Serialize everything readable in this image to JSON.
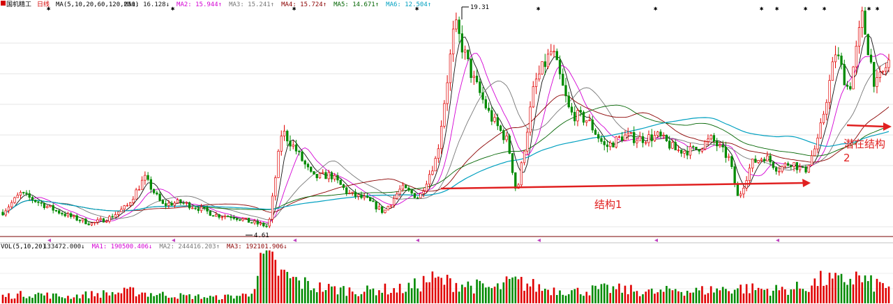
{
  "chart_data": {
    "type": "candlestick",
    "stock_name": "国机精工",
    "period_label": "日线",
    "ma_header": "MA(5,10,20,60,120,250)",
    "ma_indicators": [
      {
        "label": "MA1:",
        "value": "16.128",
        "arrow": "↓",
        "color": "#111111"
      },
      {
        "label": "MA2:",
        "value": "15.944",
        "arrow": "↑",
        "color": "#d400d4"
      },
      {
        "label": "MA3:",
        "value": "15.241",
        "arrow": "↑",
        "color": "#777777"
      },
      {
        "label": "MA4:",
        "value": "15.724",
        "arrow": "↑",
        "color": "#8b0000"
      },
      {
        "label": "MA5:",
        "value": "14.671",
        "arrow": "↑",
        "color": "#006400"
      },
      {
        "label": "MA6:",
        "value": "12.504",
        "arrow": "↑",
        "color": "#00a0c0"
      }
    ],
    "high_label": "19.31",
    "low_label": "4.61",
    "volume_header": "VOL(5,10,20)",
    "volume_indicators": [
      {
        "label": "",
        "value": "133472.000",
        "arrow": "↓",
        "color": "#111111"
      },
      {
        "label": "MA1:",
        "value": "190500.406",
        "arrow": "↓",
        "color": "#d400d4"
      },
      {
        "label": "MA2:",
        "value": "244416.203",
        "arrow": "↑",
        "color": "#777777"
      },
      {
        "label": "MA3:",
        "value": "192101.906",
        "arrow": "↓",
        "color": "#8b0000"
      }
    ],
    "annotations": [
      {
        "text": "结构1",
        "color": "#e02020"
      },
      {
        "text": "潜在结构",
        "color": "#e02020"
      },
      {
        "text": "2",
        "color": "#e02020"
      }
    ],
    "price_series": [
      {
        "t": 0,
        "p": 5.6
      },
      {
        "t": 0.02,
        "p": 6.9
      },
      {
        "t": 0.04,
        "p": 6.3
      },
      {
        "t": 0.06,
        "p": 5.7
      },
      {
        "t": 0.08,
        "p": 5.2
      },
      {
        "t": 0.1,
        "p": 4.8
      },
      {
        "t": 0.12,
        "p": 5.2
      },
      {
        "t": 0.14,
        "p": 6.0
      },
      {
        "t": 0.16,
        "p": 8.0
      },
      {
        "t": 0.18,
        "p": 6.1
      },
      {
        "t": 0.2,
        "p": 6.3
      },
      {
        "t": 0.22,
        "p": 5.9
      },
      {
        "t": 0.24,
        "p": 5.4
      },
      {
        "t": 0.26,
        "p": 5.3
      },
      {
        "t": 0.28,
        "p": 4.9
      },
      {
        "t": 0.3,
        "p": 4.6
      },
      {
        "t": 0.315,
        "p": 11.3
      },
      {
        "t": 0.33,
        "p": 10.0
      },
      {
        "t": 0.35,
        "p": 8.0
      },
      {
        "t": 0.37,
        "p": 8.2
      },
      {
        "t": 0.39,
        "p": 6.9
      },
      {
        "t": 0.41,
        "p": 6.5
      },
      {
        "t": 0.43,
        "p": 5.6
      },
      {
        "t": 0.45,
        "p": 7.3
      },
      {
        "t": 0.47,
        "p": 6.6
      },
      {
        "t": 0.49,
        "p": 9.5
      },
      {
        "t": 0.51,
        "p": 18.7
      },
      {
        "t": 0.53,
        "p": 15.0
      },
      {
        "t": 0.55,
        "p": 12.3
      },
      {
        "t": 0.57,
        "p": 10.5
      },
      {
        "t": 0.58,
        "p": 6.8
      },
      {
        "t": 0.6,
        "p": 14.5
      },
      {
        "t": 0.62,
        "p": 16.9
      },
      {
        "t": 0.64,
        "p": 12.5
      },
      {
        "t": 0.66,
        "p": 12.0
      },
      {
        "t": 0.68,
        "p": 10.1
      },
      {
        "t": 0.7,
        "p": 10.9
      },
      {
        "t": 0.72,
        "p": 10.7
      },
      {
        "t": 0.74,
        "p": 10.9
      },
      {
        "t": 0.76,
        "p": 9.9
      },
      {
        "t": 0.78,
        "p": 9.9
      },
      {
        "t": 0.8,
        "p": 10.7
      },
      {
        "t": 0.82,
        "p": 9.3
      },
      {
        "t": 0.83,
        "p": 6.5
      },
      {
        "t": 0.845,
        "p": 9.0
      },
      {
        "t": 0.86,
        "p": 9.5
      },
      {
        "t": 0.875,
        "p": 8.6
      },
      {
        "t": 0.89,
        "p": 9.1
      },
      {
        "t": 0.905,
        "p": 8.4
      },
      {
        "t": 0.92,
        "p": 10.5
      },
      {
        "t": 0.94,
        "p": 16.8
      },
      {
        "t": 0.955,
        "p": 14.0
      },
      {
        "t": 0.97,
        "p": 19.2
      },
      {
        "t": 0.985,
        "p": 14.3
      },
      {
        "t": 1,
        "p": 16.1
      }
    ],
    "volume_series": [
      0.15,
      0.18,
      0.2,
      0.16,
      0.14,
      0.18,
      0.2,
      0.22,
      0.25,
      0.2,
      0.18,
      0.15,
      0.14,
      0.12,
      0.15,
      0.18,
      1.0,
      0.6,
      0.45,
      0.35,
      0.3,
      0.28,
      0.25,
      0.3,
      0.28,
      0.35,
      0.5,
      0.45,
      0.4,
      0.35,
      0.3,
      0.45,
      0.4,
      0.3,
      0.28,
      0.25,
      0.28,
      0.3,
      0.28,
      0.25,
      0.22,
      0.3,
      0.25,
      0.28,
      0.3,
      0.32,
      0.3,
      0.28,
      0.3,
      0.35,
      0.5,
      0.45,
      0.55,
      0.4,
      0.38
    ]
  }
}
